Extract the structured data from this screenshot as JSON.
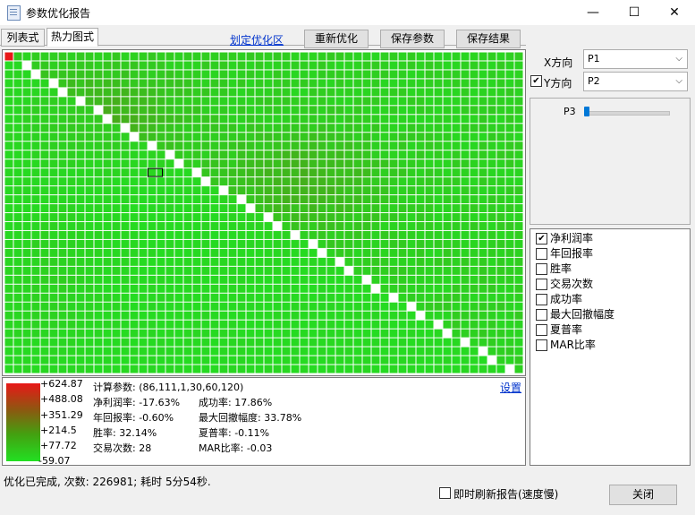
{
  "window": {
    "title": "参数优化报告",
    "minimize_glyph": "—",
    "maximize_glyph": "☐",
    "close_glyph": "✕"
  },
  "tabs": {
    "list_label": "列表式",
    "heat_label": "热力图式"
  },
  "toolbar": {
    "draw_region_link": "划定优化区",
    "reoptimize_label": "重新优化",
    "save_params_label": "保存参数",
    "save_results_label": "保存结果"
  },
  "heatmap": {
    "cols": 58,
    "rows": 36,
    "color_low": "#22e022",
    "color_mid": "#4aa81a",
    "color_high": "#e81818",
    "diagonal_color": "#ffffff",
    "selected_cell": {
      "col": 16,
      "row": 13
    }
  },
  "legend": {
    "values": [
      "+624.87",
      "+488.08",
      "+351.29",
      "+214.5",
      "+77.72",
      "-59.07"
    ]
  },
  "info": {
    "calc_params": "计算参数: (86,111,1,30,60,120)",
    "net_profit": "净利润率: -17.63%",
    "annual_return": "年回报率: -0.60%",
    "win_rate": "胜率: 32.14%",
    "trade_count": "交易次数: 28",
    "success_rate": "成功率: 17.86%",
    "max_drawdown": "最大回撤幅度: 33.78%",
    "sharpe": "夏普率: -0.11%",
    "mar": "MAR比率: -0.03",
    "settings_link": "设置"
  },
  "axes": {
    "x_label": "X方向",
    "x_value": "P1",
    "y_label": "Y方向",
    "y_value": "P2",
    "y_checked": true
  },
  "slider": {
    "label": "P3",
    "value": 0
  },
  "metrics": [
    {
      "label": "净利润率",
      "checked": true
    },
    {
      "label": "年回报率",
      "checked": false
    },
    {
      "label": "胜率",
      "checked": false
    },
    {
      "label": "交易次数",
      "checked": false
    },
    {
      "label": "成功率",
      "checked": false
    },
    {
      "label": "最大回撤幅度",
      "checked": false
    },
    {
      "label": "夏普率",
      "checked": false
    },
    {
      "label": "MAR比率",
      "checked": false
    }
  ],
  "status": {
    "text": "优化已完成, 次数: 226981; 耗时 5分54秒.",
    "refresh_label": "即时刷新报告(速度慢)",
    "refresh_checked": false,
    "close_label": "关闭"
  }
}
